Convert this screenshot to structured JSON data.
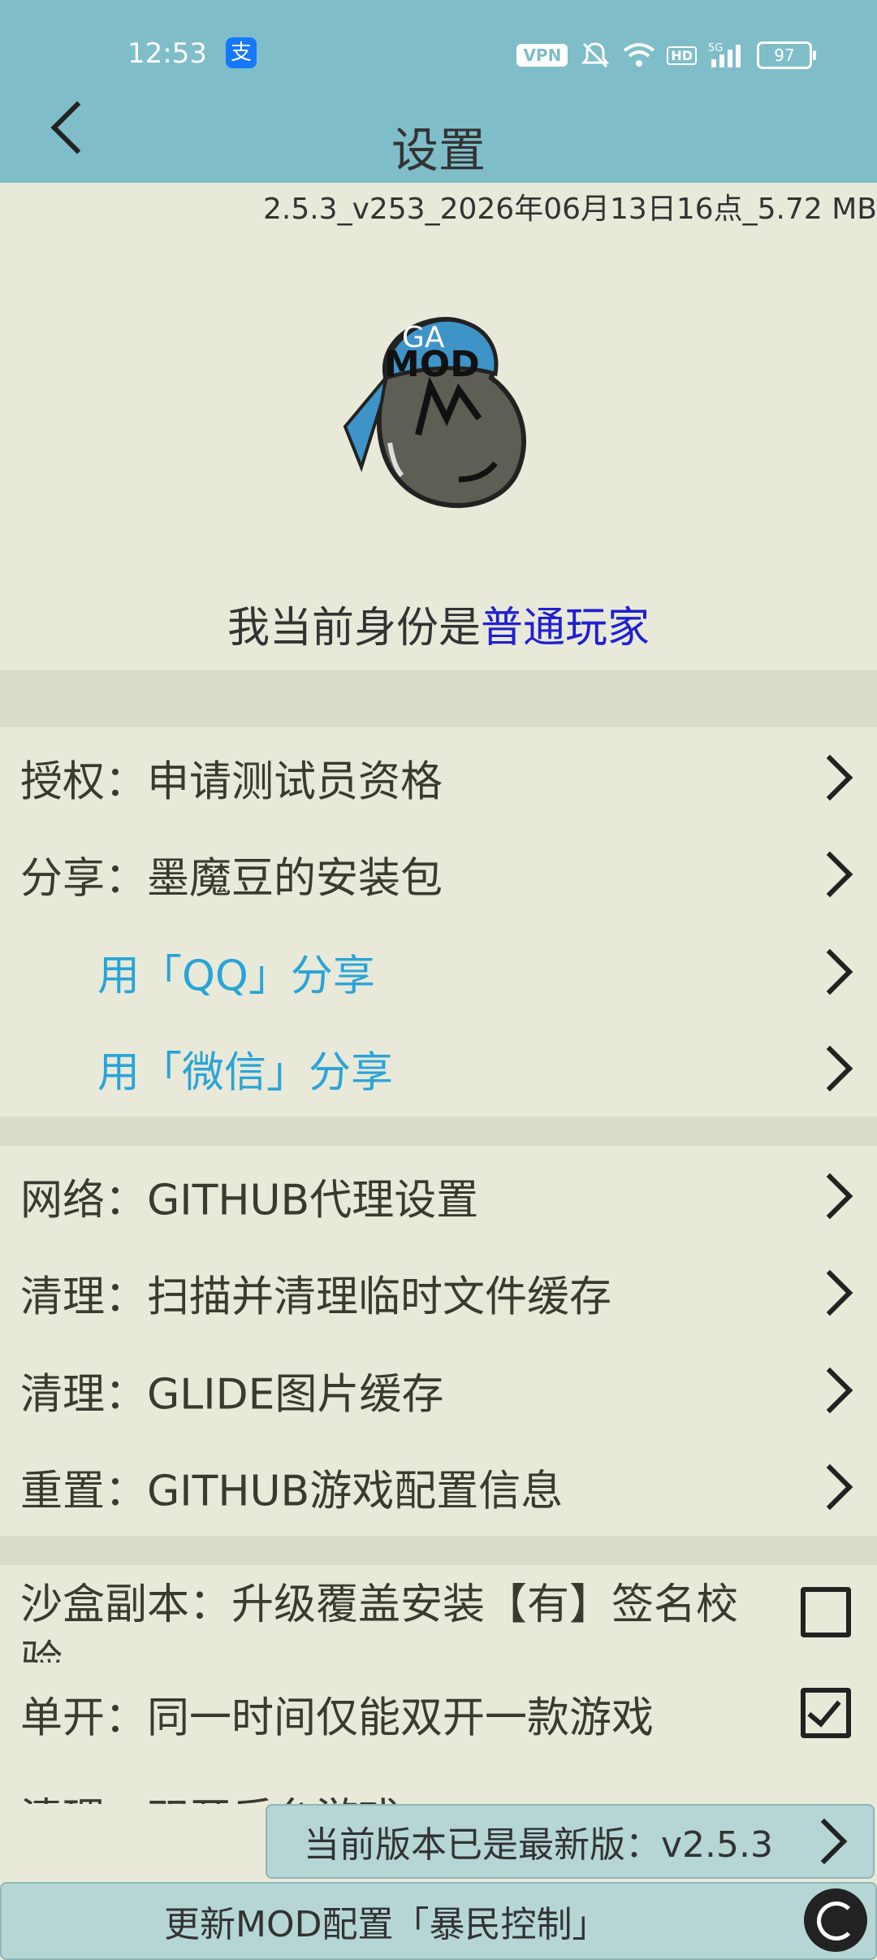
{
  "status_bar": {
    "time": "12:53",
    "alipay_glyph": "支",
    "vpn": "VPN",
    "hd": "HD",
    "signal": "5G",
    "battery": "97"
  },
  "header": {
    "title": "设置"
  },
  "version_info": "2.5.3_v253_2026年06月13日16点_5.72 MB",
  "logo_text": {
    "top": "GA",
    "bottom": "MOD"
  },
  "identity": {
    "prefix": "我当前身份是",
    "role": "普通玩家"
  },
  "menu": {
    "authorize": "授权：申请测试员资格",
    "share_pkg": "分享：墨魔豆的安装包",
    "share_qq": "用「QQ」分享",
    "share_wechat": "用「微信」分享",
    "network_proxy": "网络：GITHUB代理设置",
    "clean_temp": "清理：扫描并清理临时文件缓存",
    "clean_glide": "清理：GLIDE图片缓存",
    "reset_github": "重置：GITHUB游戏配置信息",
    "sandbox_line1": "沙盒副本：升级覆盖安装【有】签名校",
    "sandbox_line2": "验",
    "single_open": "单开：同一时间仅能双开一款游戏",
    "clean_dual": "清理：双开后台游戏"
  },
  "checkboxes": {
    "sandbox_checked": false,
    "single_open_checked": true
  },
  "toast": "当前版本已是最新版：v2.5.3",
  "bottom_bar": "更新MOD配置「暴民控制」"
}
